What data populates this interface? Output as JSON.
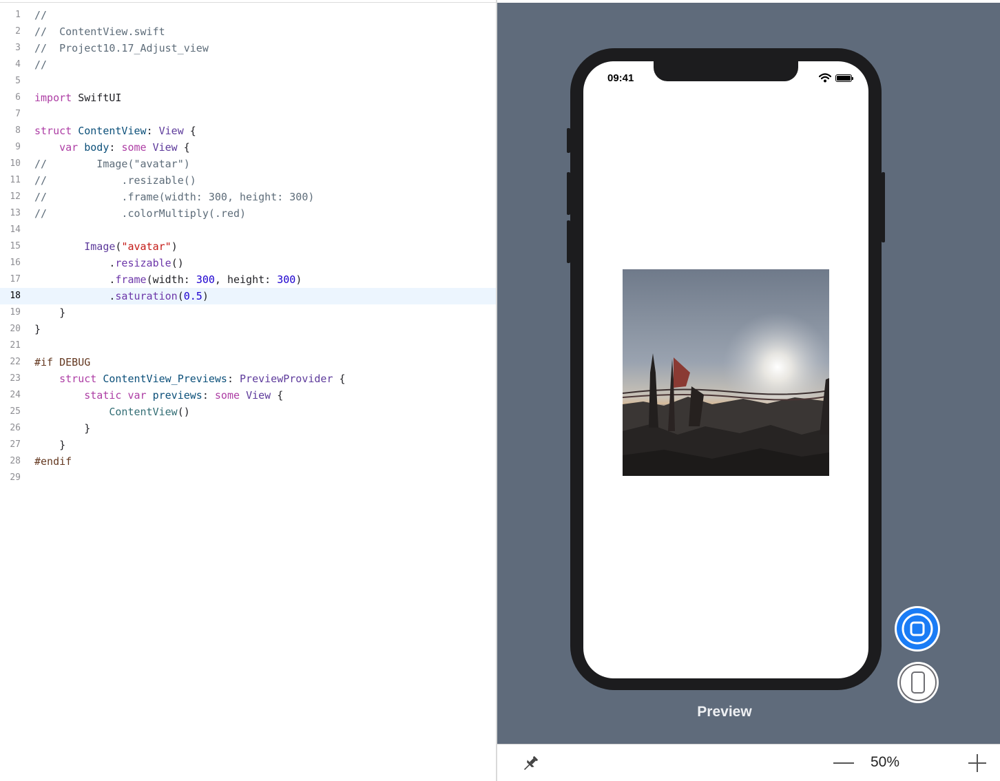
{
  "editor": {
    "current_line": 18,
    "lines": [
      {
        "n": "1",
        "segs": [
          {
            "t": "//",
            "c": "cm"
          }
        ]
      },
      {
        "n": "2",
        "segs": [
          {
            "t": "//  ContentView.swift",
            "c": "cm"
          }
        ]
      },
      {
        "n": "3",
        "segs": [
          {
            "t": "//  Project10.17_Adjust_view",
            "c": "cm"
          }
        ]
      },
      {
        "n": "4",
        "segs": [
          {
            "t": "//",
            "c": "cm"
          }
        ]
      },
      {
        "n": "5",
        "segs": []
      },
      {
        "n": "6",
        "segs": [
          {
            "t": "import",
            "c": "kw"
          },
          {
            "t": " SwiftUI",
            "c": "pl"
          }
        ]
      },
      {
        "n": "7",
        "segs": []
      },
      {
        "n": "8",
        "segs": [
          {
            "t": "struct",
            "c": "kw"
          },
          {
            "t": " ",
            "c": "pl"
          },
          {
            "t": "ContentView",
            "c": "dt"
          },
          {
            "t": ": ",
            "c": "pl"
          },
          {
            "t": "View",
            "c": "ty"
          },
          {
            "t": " {",
            "c": "pl"
          }
        ]
      },
      {
        "n": "9",
        "segs": [
          {
            "t": "    ",
            "c": "pl"
          },
          {
            "t": "var",
            "c": "kw"
          },
          {
            "t": " ",
            "c": "pl"
          },
          {
            "t": "body",
            "c": "dt"
          },
          {
            "t": ": ",
            "c": "pl"
          },
          {
            "t": "some",
            "c": "kw"
          },
          {
            "t": " ",
            "c": "pl"
          },
          {
            "t": "View",
            "c": "ty"
          },
          {
            "t": " {",
            "c": "pl"
          }
        ]
      },
      {
        "n": "10",
        "segs": [
          {
            "t": "//        Image(\"avatar\")",
            "c": "cm"
          }
        ]
      },
      {
        "n": "11",
        "segs": [
          {
            "t": "//            .resizable()",
            "c": "cm"
          }
        ]
      },
      {
        "n": "12",
        "segs": [
          {
            "t": "//            .frame(width: 300, height: 300)",
            "c": "cm"
          }
        ]
      },
      {
        "n": "13",
        "segs": [
          {
            "t": "//            .colorMultiply(.red)",
            "c": "cm"
          }
        ]
      },
      {
        "n": "14",
        "segs": []
      },
      {
        "n": "15",
        "segs": [
          {
            "t": "        ",
            "c": "pl"
          },
          {
            "t": "Image",
            "c": "ty"
          },
          {
            "t": "(",
            "c": "pl"
          },
          {
            "t": "\"avatar\"",
            "c": "st"
          },
          {
            "t": ")",
            "c": "pl"
          }
        ]
      },
      {
        "n": "16",
        "segs": [
          {
            "t": "            .",
            "c": "pl"
          },
          {
            "t": "resizable",
            "c": "mt"
          },
          {
            "t": "()",
            "c": "pl"
          }
        ]
      },
      {
        "n": "17",
        "segs": [
          {
            "t": "            .",
            "c": "pl"
          },
          {
            "t": "frame",
            "c": "mt"
          },
          {
            "t": "(width: ",
            "c": "pl"
          },
          {
            "t": "300",
            "c": "nm"
          },
          {
            "t": ", height: ",
            "c": "pl"
          },
          {
            "t": "300",
            "c": "nm"
          },
          {
            "t": ")",
            "c": "pl"
          }
        ]
      },
      {
        "n": "18",
        "segs": [
          {
            "t": "            .",
            "c": "pl"
          },
          {
            "t": "saturation",
            "c": "mt"
          },
          {
            "t": "(",
            "c": "pl"
          },
          {
            "t": "0.5",
            "c": "nm"
          },
          {
            "t": ")",
            "c": "pl"
          }
        ]
      },
      {
        "n": "19",
        "segs": [
          {
            "t": "    }",
            "c": "pl"
          }
        ]
      },
      {
        "n": "20",
        "segs": [
          {
            "t": "}",
            "c": "pl"
          }
        ]
      },
      {
        "n": "21",
        "segs": []
      },
      {
        "n": "22",
        "segs": [
          {
            "t": "#if DEBUG",
            "c": "pp"
          }
        ]
      },
      {
        "n": "23",
        "segs": [
          {
            "t": "    ",
            "c": "pl"
          },
          {
            "t": "struct",
            "c": "kw"
          },
          {
            "t": " ",
            "c": "pl"
          },
          {
            "t": "ContentView_Previews",
            "c": "dt"
          },
          {
            "t": ": ",
            "c": "pl"
          },
          {
            "t": "PreviewProvider",
            "c": "ty"
          },
          {
            "t": " {",
            "c": "pl"
          }
        ]
      },
      {
        "n": "24",
        "segs": [
          {
            "t": "        ",
            "c": "pl"
          },
          {
            "t": "static",
            "c": "kw"
          },
          {
            "t": " ",
            "c": "pl"
          },
          {
            "t": "var",
            "c": "kw"
          },
          {
            "t": " ",
            "c": "pl"
          },
          {
            "t": "previews",
            "c": "dt"
          },
          {
            "t": ": ",
            "c": "pl"
          },
          {
            "t": "some",
            "c": "kw"
          },
          {
            "t": " ",
            "c": "pl"
          },
          {
            "t": "View",
            "c": "ty"
          },
          {
            "t": " {",
            "c": "pl"
          }
        ]
      },
      {
        "n": "25",
        "segs": [
          {
            "t": "            ",
            "c": "pl"
          },
          {
            "t": "ContentView",
            "c": "fn"
          },
          {
            "t": "()",
            "c": "pl"
          }
        ]
      },
      {
        "n": "26",
        "segs": [
          {
            "t": "        }",
            "c": "pl"
          }
        ]
      },
      {
        "n": "27",
        "segs": [
          {
            "t": "    }",
            "c": "pl"
          }
        ]
      },
      {
        "n": "28",
        "segs": [
          {
            "t": "#endif",
            "c": "pp"
          }
        ]
      },
      {
        "n": "29",
        "segs": []
      }
    ]
  },
  "preview": {
    "status_time": "09:41",
    "label": "Preview",
    "accent_color": "#1a7cf5",
    "canvas_color": "#5f6b7b"
  },
  "bottom_bar": {
    "zoom_level": "50%",
    "icons": [
      "pin-icon",
      "zoom-out-icon",
      "zoom-in-icon"
    ]
  }
}
